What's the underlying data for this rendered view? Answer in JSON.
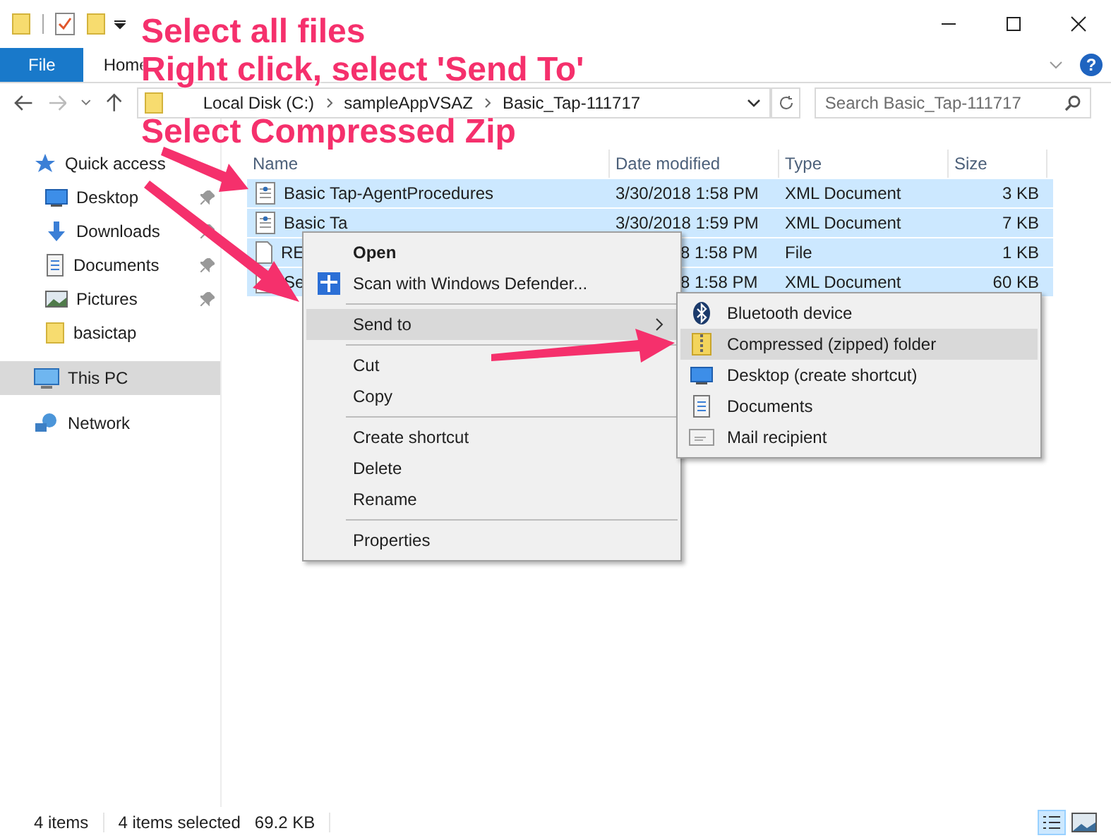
{
  "ribbon": {
    "tabs": [
      {
        "label": "File",
        "kind": "file"
      },
      {
        "label": "Home",
        "kind": "tab"
      }
    ],
    "help": "?"
  },
  "address_bar": {
    "path": [
      "Local Disk (C:)",
      "sampleAppVSAZ",
      "Basic_Tap-111717"
    ]
  },
  "search": {
    "placeholder": "Search Basic_Tap-111717"
  },
  "navigation": {
    "items": [
      {
        "label": "Quick access",
        "kind": "star",
        "pinned": false,
        "selected": false,
        "children": [
          {
            "label": "Desktop",
            "kind": "desktop",
            "pinned": true,
            "selected": false
          },
          {
            "label": "Downloads",
            "kind": "download",
            "pinned": true,
            "selected": false
          },
          {
            "label": "Documents",
            "kind": "documents",
            "pinned": true,
            "selected": false
          },
          {
            "label": "Pictures",
            "kind": "pictures",
            "pinned": true,
            "selected": false
          },
          {
            "label": "basictap",
            "kind": "folder",
            "pinned": false,
            "selected": false
          }
        ]
      },
      {
        "label": "This PC",
        "kind": "pc",
        "pinned": false,
        "selected": true
      },
      {
        "label": "Network",
        "kind": "network",
        "pinned": false,
        "selected": false
      }
    ]
  },
  "file_list": {
    "columns": [
      "Name",
      "Date modified",
      "Type",
      "Size"
    ],
    "rows": [
      {
        "kind": "xml",
        "name": "Basic Tap-AgentProcedures",
        "date": "3/30/2018 1:58 PM",
        "type": "XML Document",
        "size": "3 KB",
        "selected": true
      },
      {
        "kind": "xml",
        "name": "Basic Ta",
        "date": "3/30/2018 1:59 PM",
        "type": "XML Document",
        "size": "7 KB",
        "selected": true
      },
      {
        "kind": "file",
        "name": "RE",
        "date": "8 1:58 PM",
        "type": "File",
        "size": "1 KB",
        "selected": true
      },
      {
        "kind": "xml",
        "name": "Se",
        "date": "8 1:58 PM",
        "type": "XML Document",
        "size": "60 KB",
        "selected": true
      }
    ]
  },
  "context_menu": {
    "items": [
      {
        "kind": "item",
        "label": "Open",
        "bold": true,
        "selected": false
      },
      {
        "kind": "defender",
        "label": "Scan with Windows Defender...",
        "bold": false,
        "selected": false
      },
      {
        "kind": "separator"
      },
      {
        "kind": "submenu",
        "label": "Send to",
        "bold": false,
        "selected": true
      },
      {
        "kind": "separator"
      },
      {
        "kind": "item",
        "label": "Cut",
        "bold": false,
        "selected": false
      },
      {
        "kind": "item",
        "label": "Copy",
        "bold": false,
        "selected": false
      },
      {
        "kind": "separator"
      },
      {
        "kind": "item",
        "label": "Create shortcut",
        "bold": false,
        "selected": false
      },
      {
        "kind": "item",
        "label": "Delete",
        "bold": false,
        "selected": false
      },
      {
        "kind": "item",
        "label": "Rename",
        "bold": false,
        "selected": false
      },
      {
        "kind": "separator"
      },
      {
        "kind": "item",
        "label": "Properties",
        "bold": false,
        "selected": false
      }
    ]
  },
  "send_to_menu": {
    "items": [
      {
        "label": "Bluetooth device",
        "kind": "bluetooth",
        "selected": false
      },
      {
        "label": "Compressed (zipped) folder",
        "kind": "zip",
        "selected": true
      },
      {
        "label": "Desktop (create shortcut)",
        "kind": "desktop",
        "selected": false
      },
      {
        "label": "Documents",
        "kind": "documents",
        "selected": false
      },
      {
        "label": "Mail recipient",
        "kind": "mail",
        "selected": false
      }
    ]
  },
  "status_bar": {
    "count": "4 items",
    "selection": "4 items selected",
    "size": "69.2 KB"
  },
  "annotation": {
    "lines": [
      "Select all files",
      "Right click, select 'Send To'",
      "Select Compressed Zip"
    ]
  }
}
